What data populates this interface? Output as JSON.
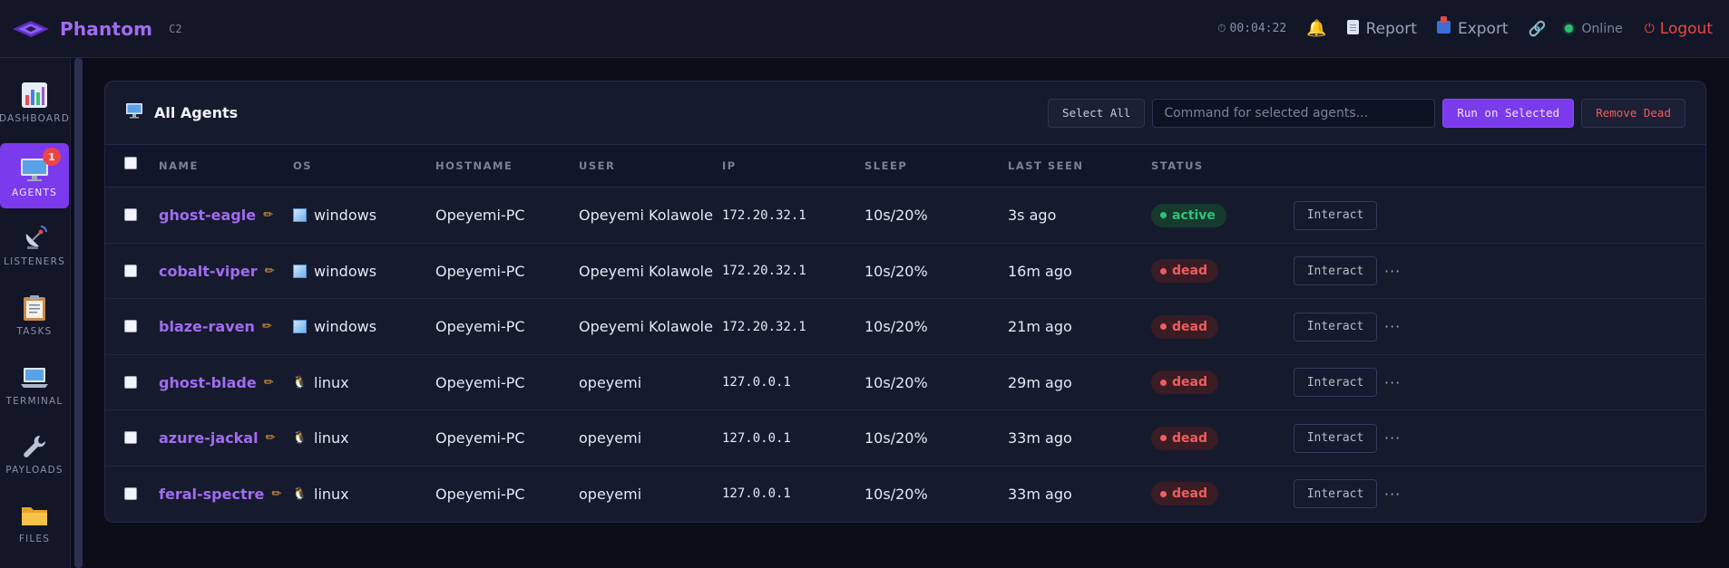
{
  "brand": {
    "name": "Phantom",
    "tag": "C2"
  },
  "topbar": {
    "timer": "00:04:22",
    "report_label": "Report",
    "export_label": "Export",
    "status_label": "Online",
    "logout_label": "Logout"
  },
  "sidebar": {
    "items": [
      {
        "label": "DASHBOARD",
        "icon": "chart-icon"
      },
      {
        "label": "AGENTS",
        "icon": "monitor-icon",
        "badge": "1"
      },
      {
        "label": "LISTENERS",
        "icon": "satellite-icon"
      },
      {
        "label": "TASKS",
        "icon": "clipboard-icon"
      },
      {
        "label": "TERMINAL",
        "icon": "laptop-icon"
      },
      {
        "label": "PAYLOADS",
        "icon": "wrench-icon"
      },
      {
        "label": "FILES",
        "icon": "folder-icon"
      }
    ]
  },
  "panel": {
    "title": "All Agents",
    "select_all_label": "Select All",
    "command_placeholder": "Command for selected agents...",
    "run_label": "Run on Selected",
    "remove_dead_label": "Remove Dead"
  },
  "table": {
    "headers": [
      "NAME",
      "OS",
      "HOSTNAME",
      "USER",
      "IP",
      "SLEEP",
      "LAST SEEN",
      "STATUS"
    ],
    "interact_label": "Interact",
    "more_label": "···",
    "rows": [
      {
        "name": "ghost-eagle",
        "os": "windows",
        "hostname": "Opeyemi-PC",
        "user": "Opeyemi Kolawole",
        "ip": "172.20.32.1",
        "sleep": "10s/20%",
        "last_seen": "3s ago",
        "status": "active"
      },
      {
        "name": "cobalt-viper",
        "os": "windows",
        "hostname": "Opeyemi-PC",
        "user": "Opeyemi Kolawole",
        "ip": "172.20.32.1",
        "sleep": "10s/20%",
        "last_seen": "16m ago",
        "status": "dead"
      },
      {
        "name": "blaze-raven",
        "os": "windows",
        "hostname": "Opeyemi-PC",
        "user": "Opeyemi Kolawole",
        "ip": "172.20.32.1",
        "sleep": "10s/20%",
        "last_seen": "21m ago",
        "status": "dead"
      },
      {
        "name": "ghost-blade",
        "os": "linux",
        "hostname": "Opeyemi-PC",
        "user": "opeyemi",
        "ip": "127.0.0.1",
        "sleep": "10s/20%",
        "last_seen": "29m ago",
        "status": "dead"
      },
      {
        "name": "azure-jackal",
        "os": "linux",
        "hostname": "Opeyemi-PC",
        "user": "opeyemi",
        "ip": "127.0.0.1",
        "sleep": "10s/20%",
        "last_seen": "33m ago",
        "status": "dead"
      },
      {
        "name": "feral-spectre",
        "os": "linux",
        "hostname": "Opeyemi-PC",
        "user": "opeyemi",
        "ip": "127.0.0.1",
        "sleep": "10s/20%",
        "last_seen": "33m ago",
        "status": "dead"
      }
    ]
  },
  "colors": {
    "accent": "#7c3aed",
    "brand": "#a06cf0",
    "active": "#2fc27a",
    "dead": "#ef5d5d",
    "background": "#0b0d18"
  }
}
